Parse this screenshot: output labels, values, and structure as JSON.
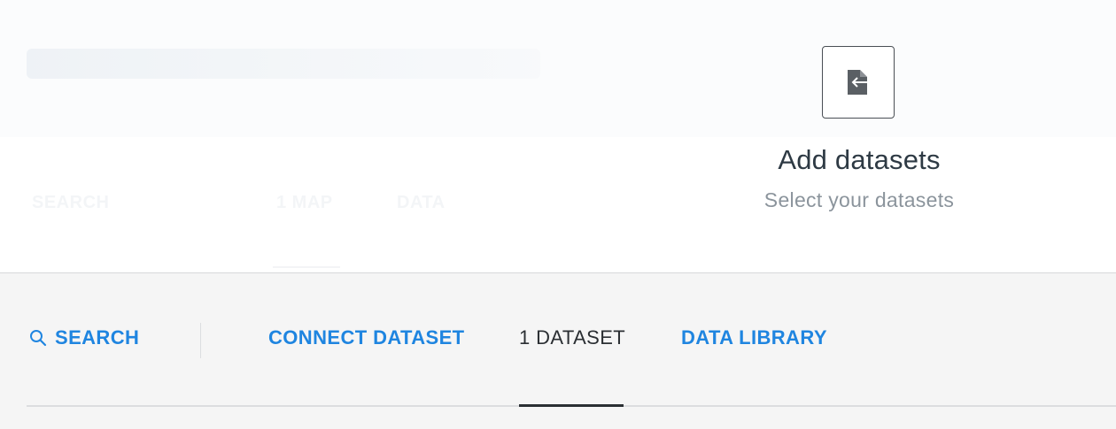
{
  "background": {
    "tabs": [
      "SEARCH",
      "1 MAP",
      "DATA"
    ]
  },
  "modal": {
    "icon": "add-dataset-icon",
    "title": "Add datasets",
    "subtitle": "Select your datasets"
  },
  "tabs": {
    "search_label": "SEARCH",
    "search_icon": "search-icon",
    "connect_label": "CONNECT DATASET",
    "dataset_label": "1 DATASET",
    "library_label": "DATA LIBRARY"
  },
  "colors": {
    "accent": "#1f85e0",
    "text_dark": "#2e3a44",
    "text_muted": "#8b949c"
  }
}
